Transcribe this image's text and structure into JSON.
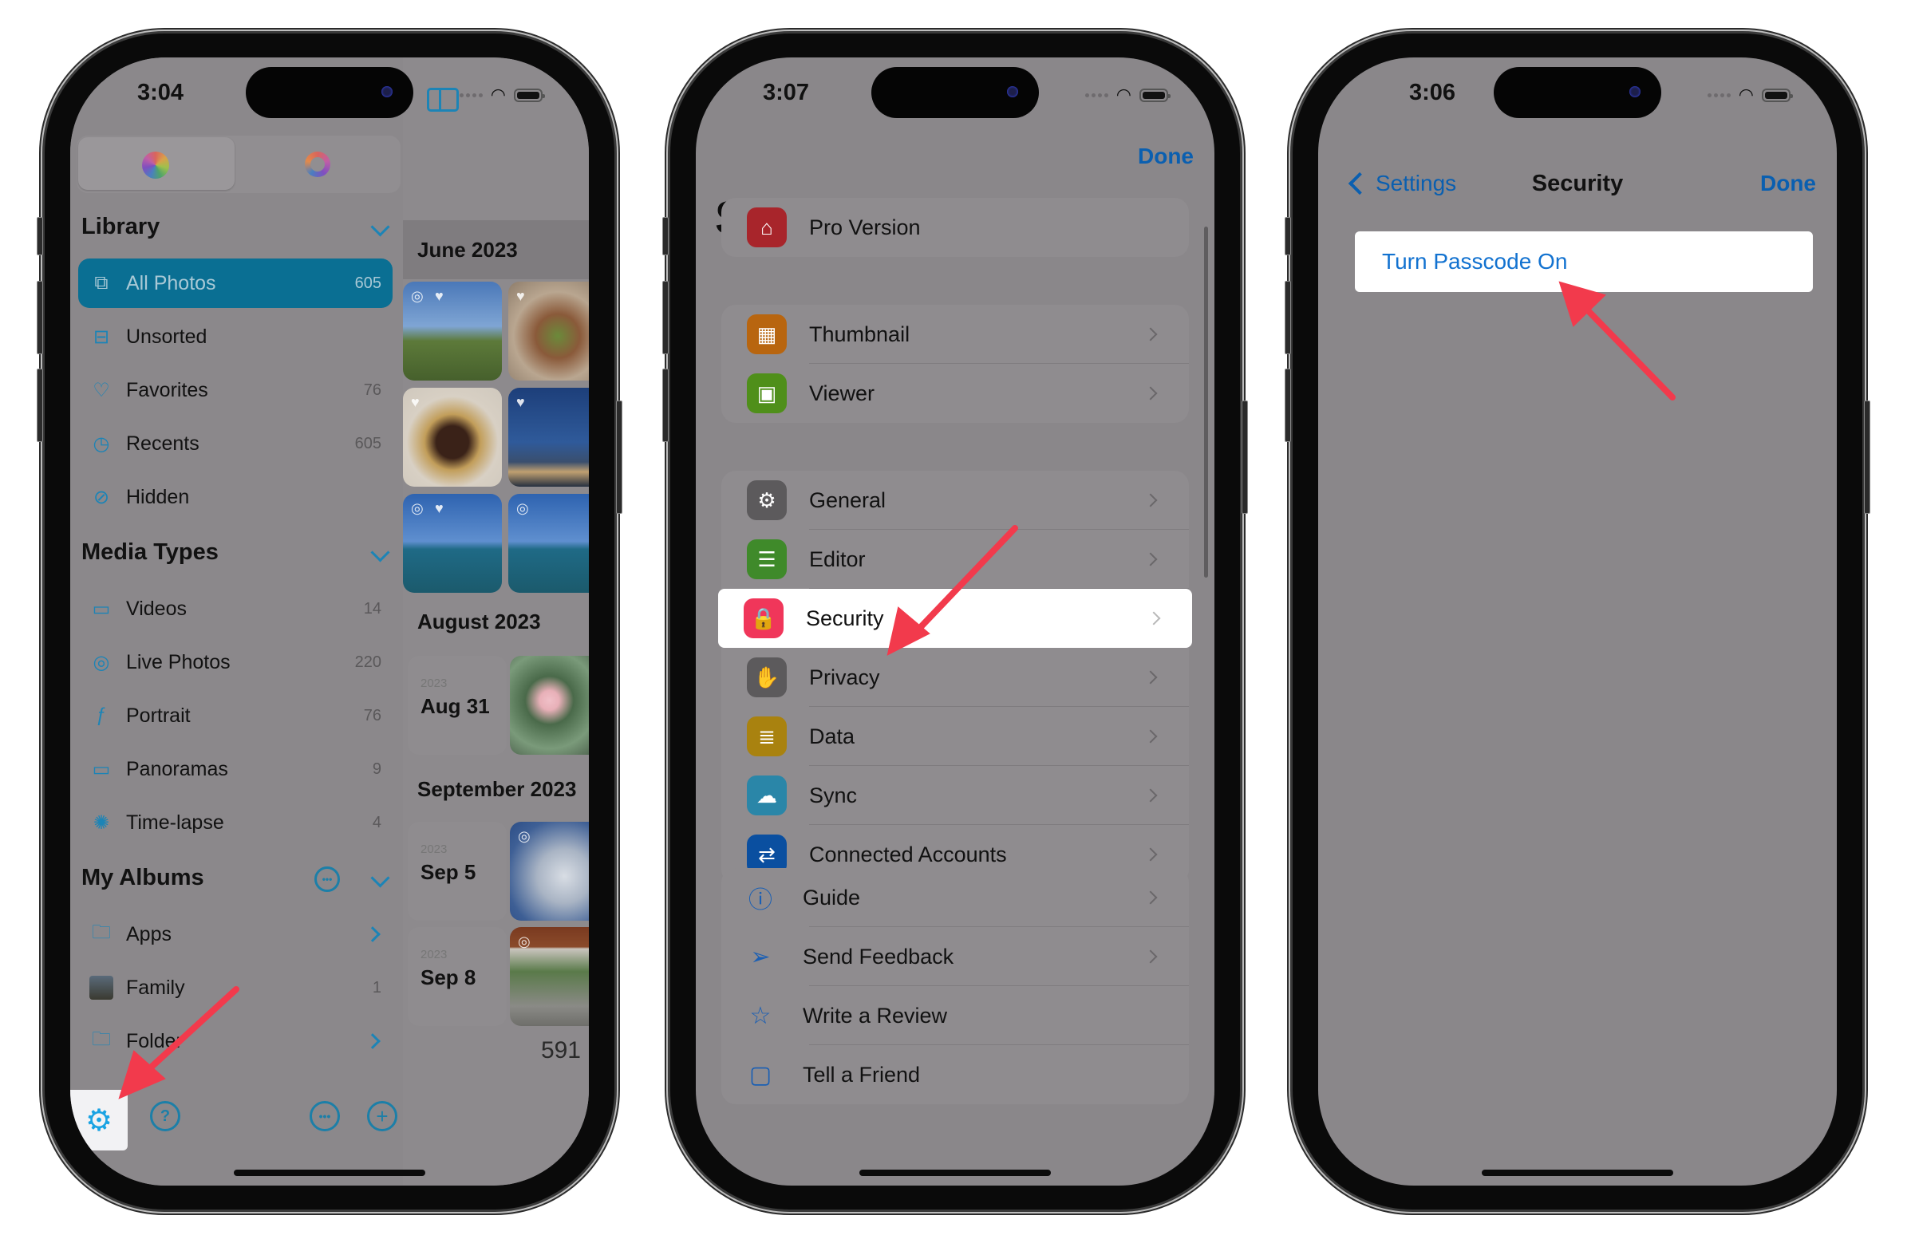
{
  "phones": [
    {
      "status_time": "3:04",
      "segment": {
        "photos_app": "photos-app-icon",
        "other_app": "ring-app-icon"
      },
      "library": {
        "title": "Library",
        "items": [
          {
            "label": "All Photos",
            "count": "605",
            "icon": "stacked-photos-icon",
            "glyph": "⧉",
            "selected": true
          },
          {
            "label": "Unsorted",
            "count": "",
            "icon": "tray-icon",
            "glyph": "⊟"
          },
          {
            "label": "Favorites",
            "count": "76",
            "icon": "heart-icon",
            "glyph": "♡"
          },
          {
            "label": "Recents",
            "count": "605",
            "icon": "clock-icon",
            "glyph": "◷"
          },
          {
            "label": "Hidden",
            "count": "",
            "icon": "eye-slash-icon",
            "glyph": "⊘"
          }
        ]
      },
      "media_types": {
        "title": "Media Types",
        "items": [
          {
            "label": "Videos",
            "count": "14",
            "icon": "video-icon",
            "glyph": "▭"
          },
          {
            "label": "Live Photos",
            "count": "220",
            "icon": "live-photo-icon",
            "glyph": "◎"
          },
          {
            "label": "Portrait",
            "count": "76",
            "icon": "portrait-icon",
            "glyph": "ƒ"
          },
          {
            "label": "Panoramas",
            "count": "9",
            "icon": "panorama-icon",
            "glyph": "▭"
          },
          {
            "label": "Time-lapse",
            "count": "4",
            "icon": "timelapse-icon",
            "glyph": "✺"
          }
        ]
      },
      "albums": {
        "title": "My Albums",
        "items": [
          {
            "label": "Apps",
            "count": "",
            "icon": "folder-icon",
            "glyph": "🗀",
            "chevron": true
          },
          {
            "label": "Family",
            "count": "1",
            "icon": "album-thumbnail",
            "glyph": "",
            "chevron": false
          },
          {
            "label": "Folder",
            "count": "",
            "icon": "folder-icon",
            "glyph": "🗀",
            "chevron": true
          }
        ]
      },
      "bottom_bar": {
        "settings": "gear-icon",
        "help": "?",
        "more": "•••",
        "add": "+"
      },
      "months": [
        {
          "title": "June 2023"
        },
        {
          "title": "August 2023",
          "cards": [
            {
              "year": "2023",
              "date": "Aug 31"
            }
          ]
        },
        {
          "title": "September 2023",
          "cards": [
            {
              "year": "2023",
              "date": "Sep 5"
            },
            {
              "year": "2023",
              "date": "Sep 8"
            }
          ]
        }
      ],
      "total_count": "591"
    },
    {
      "status_time": "3:07",
      "done": "Done",
      "title": "Settings",
      "groups": [
        [
          {
            "label": "Pro Version",
            "icon": "store-icon",
            "color": "#a8252b",
            "glyph": "⌂",
            "chevron": false
          }
        ],
        [
          {
            "label": "Thumbnail",
            "icon": "grid-icon",
            "color": "#b8650f",
            "glyph": "▦",
            "chevron": true
          },
          {
            "label": "Viewer",
            "icon": "image-icon",
            "color": "#4f8f1a",
            "glyph": "▣",
            "chevron": true
          }
        ],
        [
          {
            "label": "General",
            "icon": "gear-icon",
            "color": "#5c5a5c",
            "glyph": "⚙",
            "chevron": true
          },
          {
            "label": "Editor",
            "icon": "sliders-icon",
            "color": "#3f8a2a",
            "glyph": "☰",
            "chevron": true
          },
          {
            "label": "Security",
            "icon": "lock-icon",
            "color": "#f0365a",
            "glyph": "🔒",
            "chevron": true,
            "highlighted": true
          },
          {
            "label": "Privacy",
            "icon": "hand-icon",
            "color": "#5c5a5c",
            "glyph": "✋",
            "chevron": true
          },
          {
            "label": "Data",
            "icon": "database-icon",
            "color": "#a9820f",
            "glyph": "≣",
            "chevron": true
          },
          {
            "label": "Sync",
            "icon": "cloud-sync-icon",
            "color": "#2a86a8",
            "glyph": "☁",
            "chevron": true
          },
          {
            "label": "Connected Accounts",
            "icon": "link-icon",
            "color": "#0a4fa0",
            "glyph": "⇄",
            "chevron": true
          }
        ],
        [
          {
            "label": "Guide",
            "icon": "question-icon",
            "glyph": "ⓘ",
            "chevron": true,
            "plain": true
          },
          {
            "label": "Send Feedback",
            "icon": "paper-plane-icon",
            "glyph": "➢",
            "chevron": true,
            "plain": true
          },
          {
            "label": "Write a Review",
            "icon": "star-icon",
            "glyph": "☆",
            "chevron": false,
            "plain": true
          },
          {
            "label": "Tell a Friend",
            "icon": "share-icon",
            "glyph": "▢",
            "chevron": false,
            "plain": true
          }
        ]
      ]
    },
    {
      "status_time": "3:06",
      "back_label": "Settings",
      "title": "Security",
      "done": "Done",
      "option": "Turn Passcode On"
    }
  ],
  "annotations": {
    "arrow_color": "#f23a4c"
  }
}
